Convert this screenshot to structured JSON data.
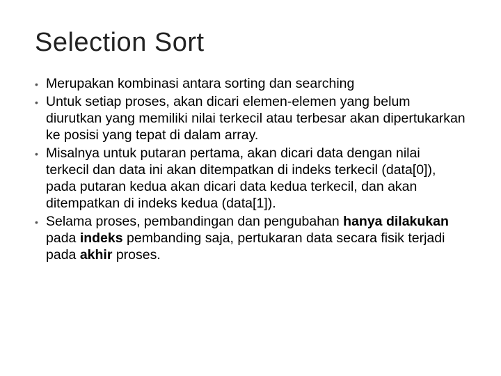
{
  "title": "Selection Sort",
  "bullets": [
    {
      "html": "Merupakan kombinasi antara sorting dan searching"
    },
    {
      "html": "Untuk setiap proses, akan dicari elemen-elemen yang belum diurutkan yang memiliki nilai terkecil atau terbesar akan dipertukarkan ke posisi yang tepat di dalam array."
    },
    {
      "html": "Misalnya untuk putaran pertama, akan dicari data dengan nilai terkecil dan data ini akan ditempatkan di indeks terkecil (data[0]), pada putaran kedua akan dicari data kedua terkecil, dan akan ditempatkan di indeks kedua (data[1])."
    },
    {
      "html": "Selama proses, pembandingan dan pengubahan <b>hanya dilakukan</b> pada <b>indeks</b> pembanding saja, pertukaran data secara fisik terjadi pada <b>akhir</b> proses."
    }
  ]
}
